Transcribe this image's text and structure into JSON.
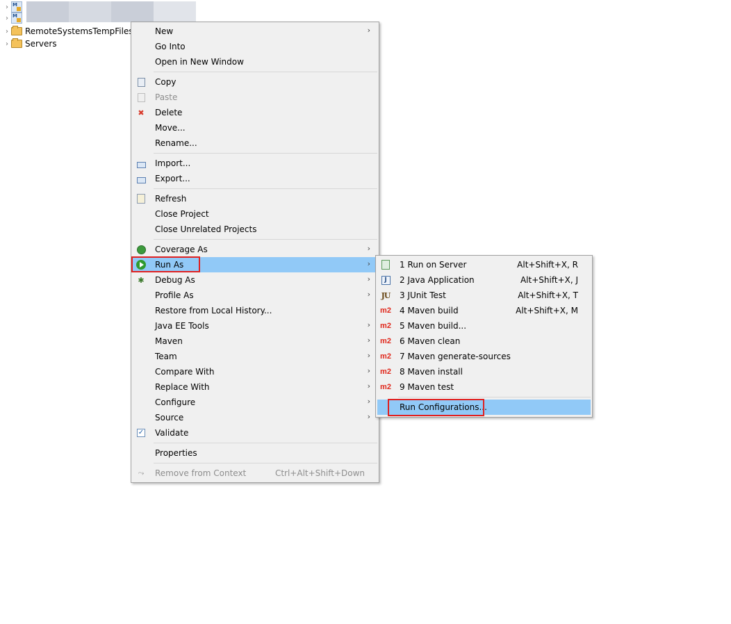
{
  "tree": {
    "items": [
      {
        "label": "",
        "icon": "maven-project-icon"
      },
      {
        "label": "",
        "icon": "maven-project-icon"
      },
      {
        "label": "RemoteSystemsTempFiles",
        "icon": "folder-icon"
      },
      {
        "label": "Servers",
        "icon": "folder-icon"
      }
    ]
  },
  "context_menu": {
    "items": [
      {
        "label": "New",
        "submenu": true
      },
      {
        "label": "Go Into"
      },
      {
        "label": "Open in New Window"
      },
      {
        "label": "Copy",
        "icon": "copy-icon"
      },
      {
        "label": "Paste",
        "icon": "paste-icon",
        "disabled": true
      },
      {
        "label": "Delete",
        "icon": "delete-icon"
      },
      {
        "label": "Move..."
      },
      {
        "label": "Rename..."
      },
      {
        "label": "Import...",
        "icon": "import-icon"
      },
      {
        "label": "Export...",
        "icon": "export-icon"
      },
      {
        "label": "Refresh",
        "icon": "refresh-icon"
      },
      {
        "label": "Close Project"
      },
      {
        "label": "Close Unrelated Projects"
      },
      {
        "label": "Coverage As",
        "icon": "coverage-icon",
        "submenu": true
      },
      {
        "label": "Run As",
        "icon": "run-icon",
        "submenu": true,
        "highlighted": true
      },
      {
        "label": "Debug As",
        "icon": "debug-icon",
        "submenu": true
      },
      {
        "label": "Profile As",
        "submenu": true
      },
      {
        "label": "Restore from Local History..."
      },
      {
        "label": "Java EE Tools",
        "submenu": true
      },
      {
        "label": "Maven",
        "submenu": true
      },
      {
        "label": "Team",
        "submenu": true
      },
      {
        "label": "Compare With",
        "submenu": true
      },
      {
        "label": "Replace With",
        "submenu": true
      },
      {
        "label": "Configure",
        "submenu": true
      },
      {
        "label": "Source",
        "submenu": true
      },
      {
        "label": "Validate",
        "icon": "checkbox-icon"
      },
      {
        "label": "Properties"
      },
      {
        "label": "Remove from Context",
        "icon": "remove-context-icon",
        "disabled": true,
        "accelerator": "Ctrl+Alt+Shift+Down"
      }
    ],
    "submenu_arrow": "›"
  },
  "run_as_submenu": {
    "items": [
      {
        "label": "1 Run on Server",
        "icon": "server-icon",
        "accelerator": "Alt+Shift+X, R"
      },
      {
        "label": "2 Java Application",
        "icon": "java-app-icon",
        "accelerator": "Alt+Shift+X, J"
      },
      {
        "label": "3 JUnit Test",
        "icon": "junit-icon",
        "icon_text": "JU",
        "accelerator": "Alt+Shift+X, T"
      },
      {
        "label": "4 Maven build",
        "icon": "m2-icon",
        "icon_text": "m2",
        "accelerator": "Alt+Shift+X, M"
      },
      {
        "label": "5 Maven build...",
        "icon": "m2-icon",
        "icon_text": "m2"
      },
      {
        "label": "6 Maven clean",
        "icon": "m2-icon",
        "icon_text": "m2"
      },
      {
        "label": "7 Maven generate-sources",
        "icon": "m2-icon",
        "icon_text": "m2"
      },
      {
        "label": "8 Maven install",
        "icon": "m2-icon",
        "icon_text": "m2"
      },
      {
        "label": "9 Maven test",
        "icon": "m2-icon",
        "icon_text": "m2"
      },
      {
        "label": "Run Configurations...",
        "highlighted": true
      }
    ]
  },
  "colors": {
    "highlight": "#91c9f7",
    "annotation_box": "#e02020",
    "menu_background": "#f0f0f0"
  }
}
